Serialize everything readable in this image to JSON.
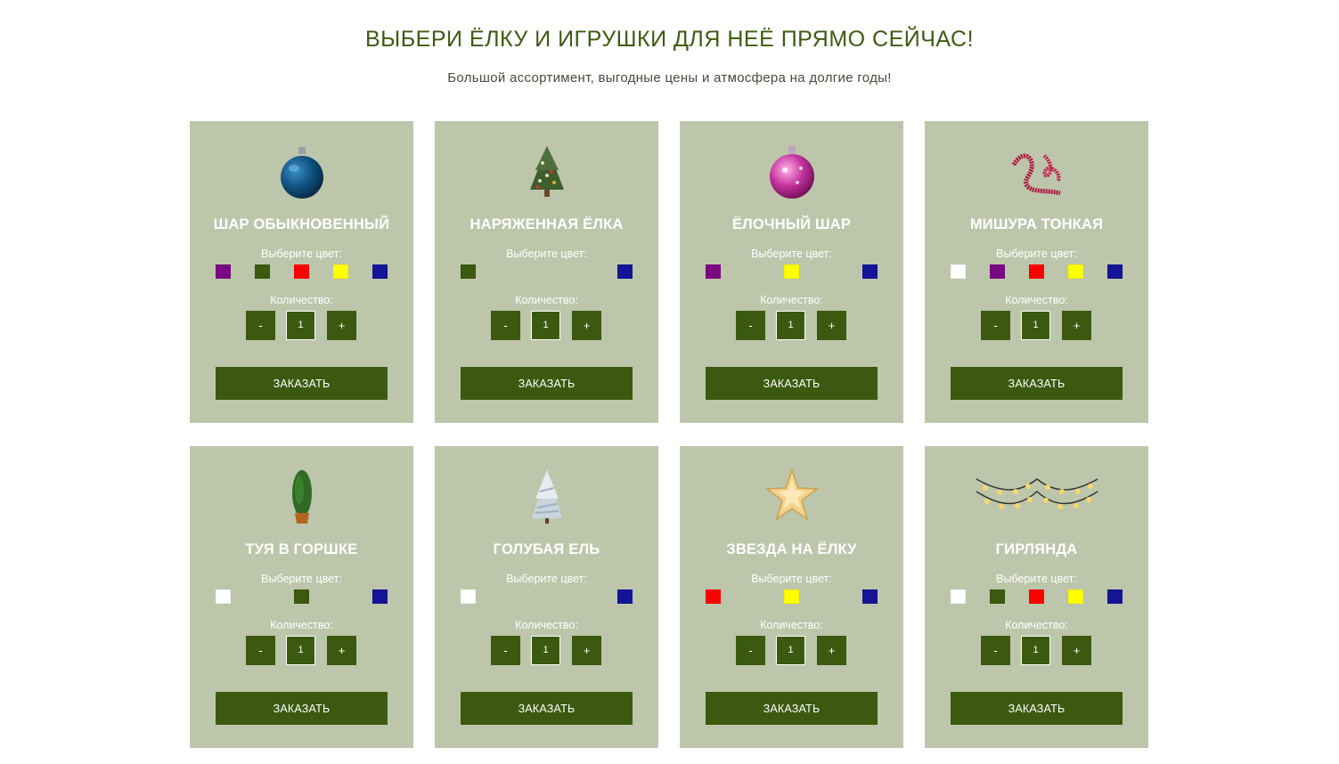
{
  "header": {
    "title": "ВЫБЕРИ ЁЛКУ И ИГРУШКИ ДЛЯ НЕЁ ПРЯМО СЕЙЧАС!",
    "subtitle": "Большой ассортимент, выгодные цены и атмосфера на долгие годы!"
  },
  "labels": {
    "choose_color": "Выберите цвет:",
    "quantity": "Количество:",
    "minus": "-",
    "plus": "+",
    "order": "ЗАКАЗАТЬ"
  },
  "colors": {
    "purple": "#7b0a82",
    "green": "#3b5a0f",
    "red": "#ff0000",
    "yellow": "#ffff00",
    "blue": "#141496",
    "white": "#ffffff",
    "card_bg": "#bdc6aa",
    "accent": "#3b5a0f"
  },
  "products": [
    {
      "name": "ШАР ОБЫКНОВЕННЫЙ",
      "icon": "blue-ornament-ball-icon",
      "colors": [
        "purple",
        "green",
        "red",
        "yellow",
        "blue"
      ],
      "quantity": "1"
    },
    {
      "name": "НАРЯЖЕННАЯ ЁЛКА",
      "icon": "decorated-tree-icon",
      "colors": [
        "green",
        null,
        null,
        null,
        "blue"
      ],
      "quantity": "1"
    },
    {
      "name": "ЁЛОЧНЫЙ ШАР",
      "icon": "pink-ornament-ball-icon",
      "colors": [
        "purple",
        null,
        "yellow",
        null,
        "blue"
      ],
      "quantity": "1"
    },
    {
      "name": "МИШУРА ТОНКАЯ",
      "icon": "tinsel-icon",
      "colors": [
        "white",
        "purple",
        "red",
        "yellow",
        "blue"
      ],
      "quantity": "1"
    },
    {
      "name": "ТУЯ В ГОРШКЕ",
      "icon": "potted-thuja-icon",
      "colors": [
        "white",
        null,
        "green",
        null,
        "blue"
      ],
      "quantity": "1"
    },
    {
      "name": "ГОЛУБАЯ ЕЛЬ",
      "icon": "blue-spruce-icon",
      "colors": [
        "white",
        null,
        null,
        null,
        "blue"
      ],
      "quantity": "1"
    },
    {
      "name": "ЗВЕЗДА НА ЁЛКУ",
      "icon": "tree-star-icon",
      "colors": [
        "red",
        null,
        "yellow",
        null,
        "blue"
      ],
      "quantity": "1"
    },
    {
      "name": "ГИРЛЯНДА",
      "icon": "light-garland-icon",
      "colors": [
        "white",
        "green",
        "red",
        "yellow",
        "blue"
      ],
      "quantity": "1"
    }
  ]
}
